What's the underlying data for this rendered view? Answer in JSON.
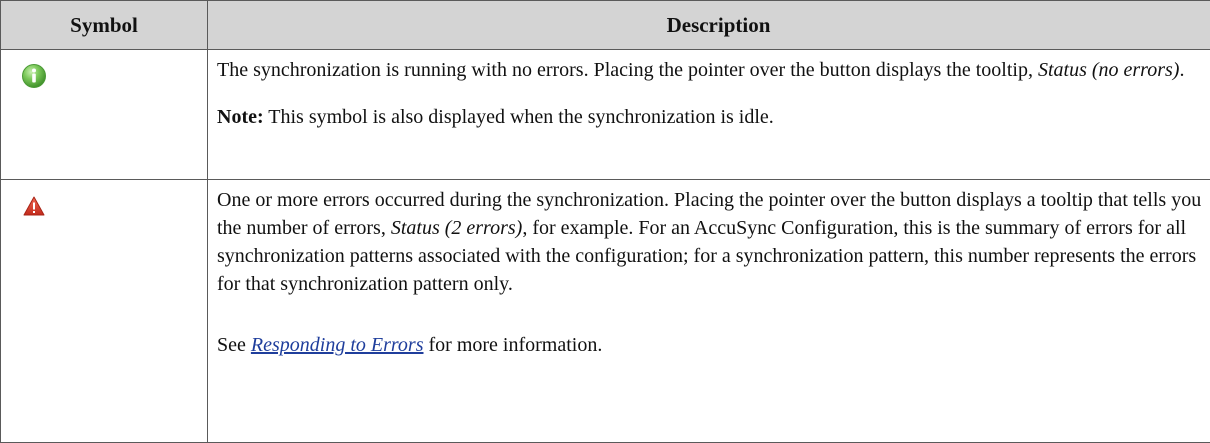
{
  "table": {
    "headers": {
      "symbol": "Symbol",
      "description": "Description"
    },
    "rows": [
      {
        "icon": "info-icon",
        "icon_color": "#5fb84a",
        "p1_text": "The synchronization is running with no errors. Placing the pointer over the button displays the tooltip, ",
        "p1_italic": "Status (no errors)",
        "p1_end": ".",
        "note_label": "Note:",
        "note_text": " This symbol is also displayed when the synchronization is idle."
      },
      {
        "icon": "warning-icon",
        "icon_color": "#d43a2a",
        "p1_text": "One or more errors occurred during the synchronization. Placing the pointer over the button displays a tooltip that tells you the number of errors, ",
        "p1_italic": "Status (2 errors)",
        "p1_end": ", for example. For an AccuSync Configuration, this is the summary of errors for all synchronization patterns associated with the configuration; for a synchronization pattern, this number represents the errors for that synchronization pattern only.",
        "see_text": "See ",
        "link_text": "Responding to Errors",
        "see_end": " for more information."
      }
    ]
  }
}
